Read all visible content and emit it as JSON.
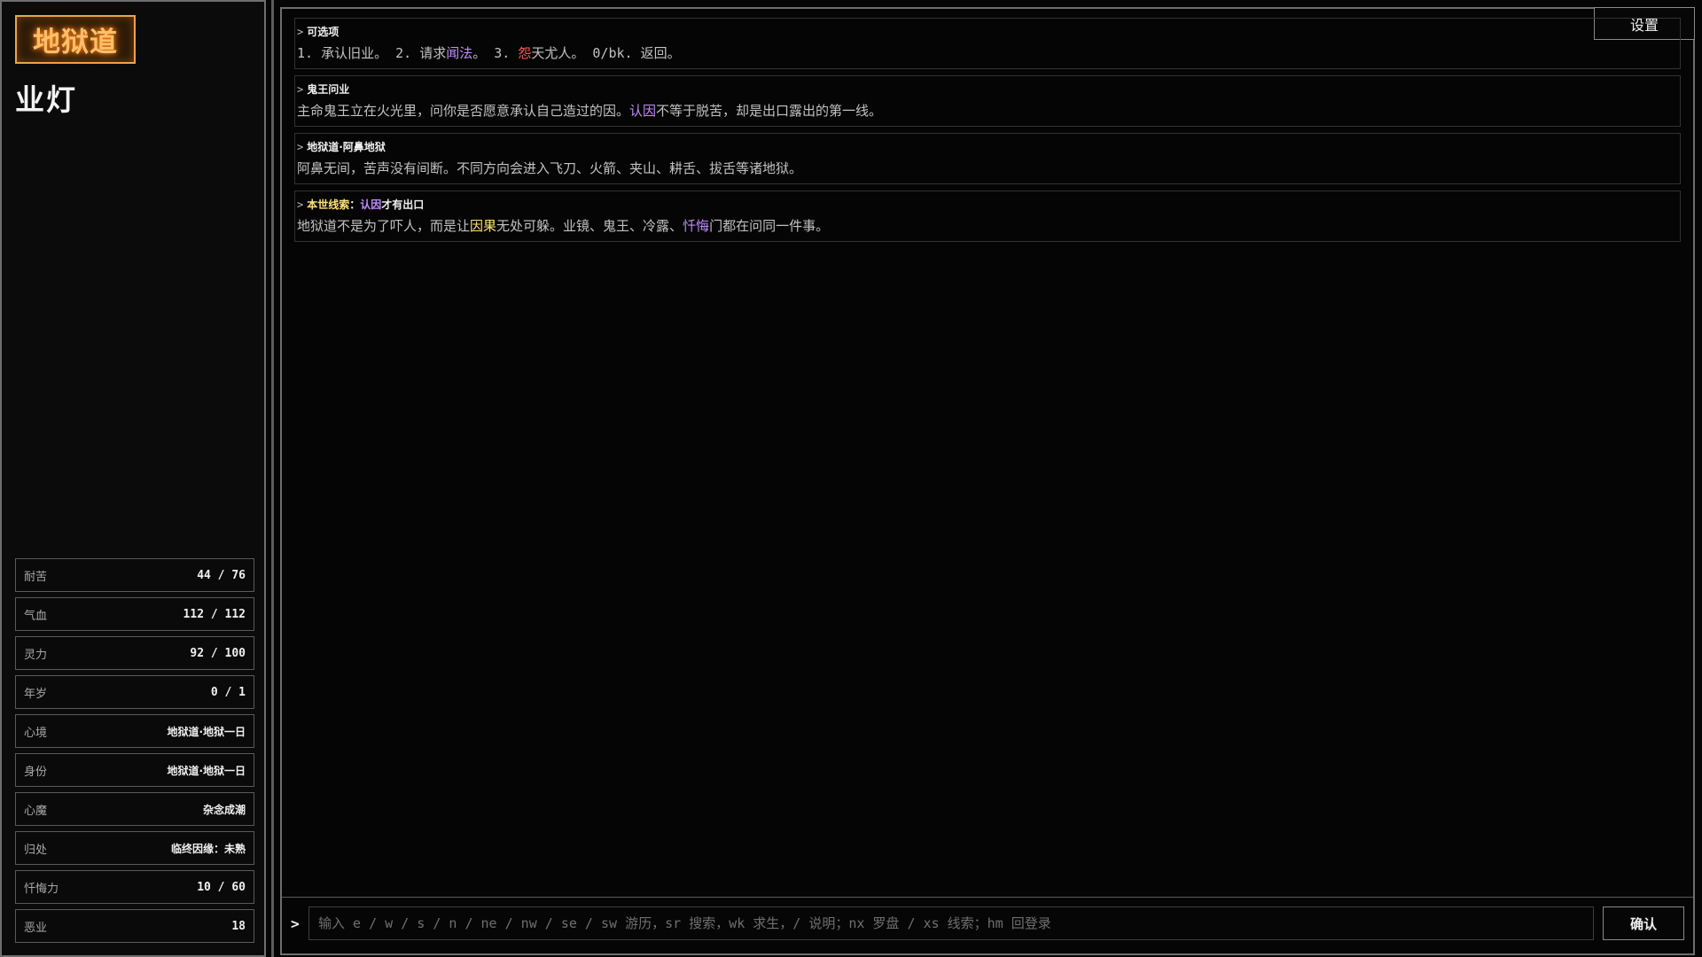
{
  "sidebar": {
    "realm": "地狱道",
    "name": "业灯",
    "stats": [
      {
        "label": "耐苦",
        "value": "44 / 76",
        "kind": "num"
      },
      {
        "label": "气血",
        "value": "112 / 112",
        "kind": "num"
      },
      {
        "label": "灵力",
        "value": "92 / 100",
        "kind": "num"
      },
      {
        "label": "年岁",
        "value": "0 / 1",
        "kind": "num"
      },
      {
        "label": "心境",
        "value": "地狱道·地狱一日",
        "kind": "text"
      },
      {
        "label": "身份",
        "value": "地狱道·地狱一日",
        "kind": "text"
      },
      {
        "label": "心魔",
        "value": "杂念成潮",
        "kind": "text"
      },
      {
        "label": "归处",
        "value": "临终因缘：未熟",
        "kind": "text"
      },
      {
        "label": "忏悔力",
        "value": "10 / 60",
        "kind": "num"
      },
      {
        "label": "恶业",
        "value": "18",
        "kind": "num"
      }
    ]
  },
  "header": {
    "settings_label": "设置"
  },
  "log": [
    {
      "title": [
        {
          "t": "可选项"
        }
      ],
      "mono": true,
      "body": [
        {
          "t": "1. 承认旧业。 2. 请求"
        },
        {
          "t": "闻法",
          "c": "purple"
        },
        {
          "t": "。 3. "
        },
        {
          "t": "怨",
          "c": "red"
        },
        {
          "t": "天尤人。 0/bk. 返回。"
        }
      ]
    },
    {
      "title": [
        {
          "t": "鬼王问业"
        }
      ],
      "mono": false,
      "body": [
        {
          "t": "主命鬼王立在火光里，问你是否愿意承认自己造过的因。"
        },
        {
          "t": "认因",
          "c": "purple"
        },
        {
          "t": "不等于脱苦，却是出口露出的第一线。"
        }
      ]
    },
    {
      "title": [
        {
          "t": "地狱道·阿鼻地狱"
        }
      ],
      "mono": false,
      "body": [
        {
          "t": "阿鼻无间，苦声没有间断。不同方向会进入飞刀、火箭、夹山、耕舌、拔舌等诸地狱。"
        }
      ]
    },
    {
      "title": [
        {
          "t": "本世线索",
          "c": "yellow"
        },
        {
          "t": "："
        },
        {
          "t": "认因",
          "c": "purple"
        },
        {
          "t": "才有出口"
        }
      ],
      "mono": false,
      "body": [
        {
          "t": "地狱道不是为了吓人，而是让"
        },
        {
          "t": "因果",
          "c": "yellow"
        },
        {
          "t": "无处可躲。业镜、鬼王、冷露、"
        },
        {
          "t": "忏悔",
          "c": "purple"
        },
        {
          "t": "门都在问同一件事。"
        }
      ]
    }
  ],
  "input": {
    "prompt": ">",
    "placeholder": "输入 e / w / s / n / ne / nw / se / sw 游历，sr 搜索，wk 求生，/ 说明；nx 罗盘 / xs 线索；hm 回登录",
    "value": "",
    "confirm_label": "确认"
  },
  "colors": {
    "accent_orange": "#ffbe6a",
    "highlight_purple": "#c08cff",
    "highlight_red": "#ff5a5a",
    "highlight_yellow": "#ffe27a"
  }
}
